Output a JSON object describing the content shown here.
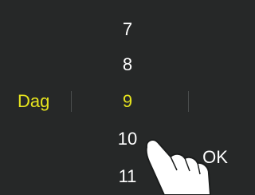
{
  "picker": {
    "label": "Dag",
    "values": [
      "7",
      "8",
      "9",
      "10",
      "11"
    ],
    "selected": "9"
  },
  "actions": {
    "ok_label": "OK"
  },
  "colors": {
    "background": "#262828",
    "accent": "#e6e41e",
    "text": "#ffffff",
    "divider": "#4a4d4d"
  },
  "icons": {
    "pointer": "pointing-hand-icon"
  }
}
